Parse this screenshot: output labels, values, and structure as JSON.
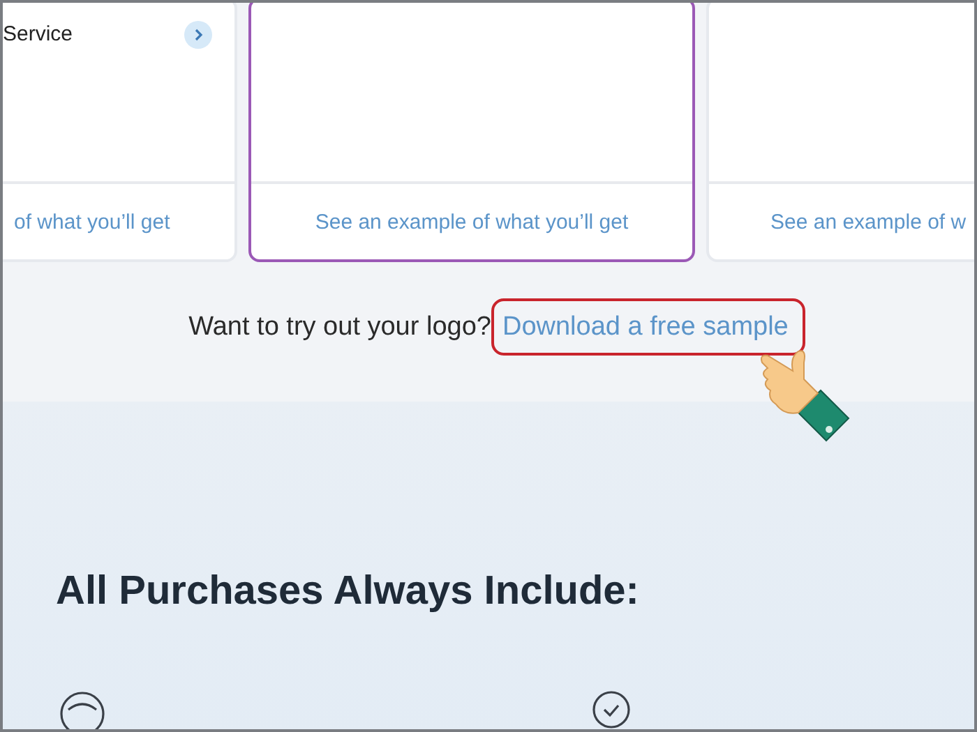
{
  "cards": [
    {
      "title": "Service",
      "has_arrow": true,
      "link": "of what you’ll get",
      "selected": false
    },
    {
      "has_arrow": false,
      "link": "See an example of what you’ll get",
      "selected": true
    },
    {
      "has_arrow": false,
      "link": "See an example of w",
      "selected": false
    }
  ],
  "sample": {
    "prompt": "Want to try out your logo?",
    "link": "Download a free sample"
  },
  "includes": {
    "heading": "All Purchases Always Include:",
    "icons": [
      {
        "kind": "gauge"
      },
      {
        "kind": "check"
      }
    ]
  }
}
